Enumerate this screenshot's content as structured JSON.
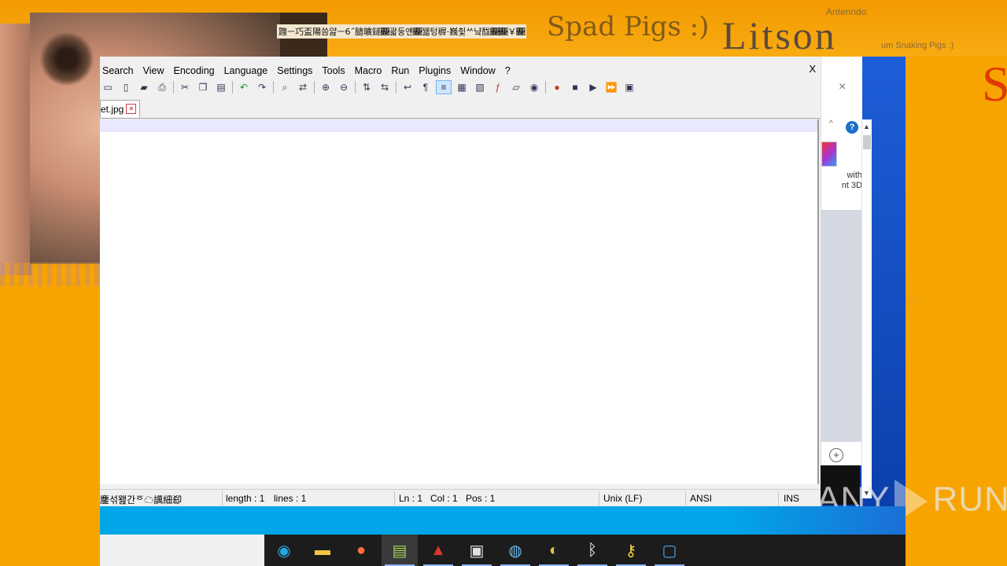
{
  "background": {
    "glitch_text": "韙ㅡ巧盃陽씀얊ㅡ6˝膸曠鐩𓳃괇둥얜𓳃꿻텅稺·巍췿ᄊ냨䤈𓳃𓳃￥𓳃",
    "stamp_text": "Spad Pigs :)",
    "title_text": "Litson",
    "small_text_1": "Antenndo",
    "small_text_2": "um Snaking Pigs :)",
    "big_letter": "S",
    "faint_text": "gs :)"
  },
  "side_window": {
    "close_glyph": "×",
    "up_glyph": "^",
    "help_glyph": "?",
    "open_with_text": "with\nnt 3D",
    "add_glyph": "+"
  },
  "notepad": {
    "menu": [
      "Search",
      "View",
      "Encoding",
      "Language",
      "Settings",
      "Tools",
      "Macro",
      "Run",
      "Plugins",
      "Window",
      "?"
    ],
    "close_label": "X",
    "tab": {
      "label": "et.jpg",
      "close_glyph": "×"
    },
    "status": {
      "file_type": "鏖섞뫮간ᅙ☁䜕細㕁",
      "length": "length : 1",
      "lines": "lines : 1",
      "ln": "Ln : 1",
      "col": "Col : 1",
      "pos": "Pos : 1",
      "eol": "Unix (LF)",
      "encoding": "ANSI",
      "mode": "INS"
    }
  },
  "watermark": {
    "left": "ANY",
    "right": "RUN"
  },
  "taskbar": {
    "apps": [
      {
        "name": "edge-icon",
        "glyph": "◉",
        "color": "#2aa7e0"
      },
      {
        "name": "file-explorer-icon",
        "glyph": "▬",
        "color": "#f5c542"
      },
      {
        "name": "firefox-icon",
        "glyph": "●",
        "color": "#ff7139"
      },
      {
        "name": "notepad-plus-plus-icon",
        "glyph": "▤",
        "color": "#9bd45b"
      },
      {
        "name": "app-icon",
        "glyph": "▲",
        "color": "#d43a2f"
      },
      {
        "name": "document-icon",
        "glyph": "▣",
        "color": "#e0e0e0"
      },
      {
        "name": "network-icon",
        "glyph": "◍",
        "color": "#6fb7e8"
      },
      {
        "name": "paint-icon",
        "glyph": "◐",
        "color": "#f0c040"
      },
      {
        "name": "bluetooth-icon",
        "glyph": "ᛒ",
        "color": "#ffffff"
      },
      {
        "name": "key-icon",
        "glyph": "⚷",
        "color": "#f4d03f"
      },
      {
        "name": "window-icon",
        "glyph": "▢",
        "color": "#4fa3e8"
      }
    ]
  }
}
